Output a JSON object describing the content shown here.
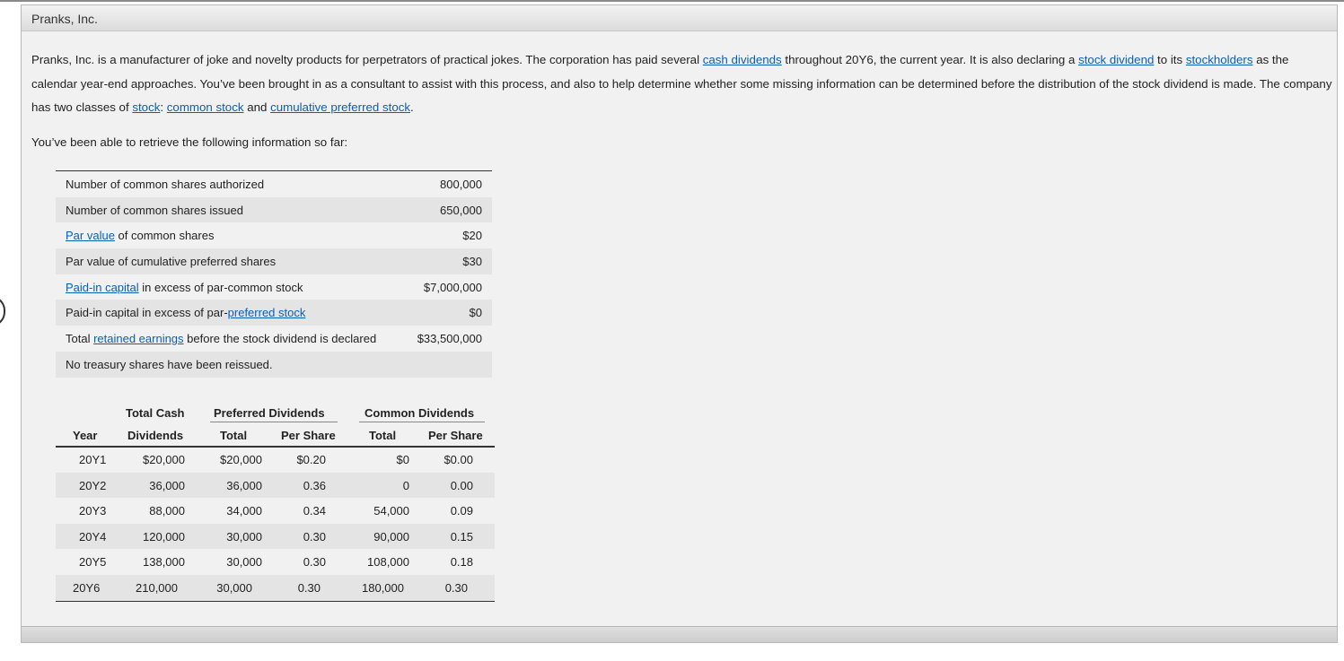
{
  "window": {
    "title": "Pranks, Inc."
  },
  "intro": {
    "t1": "Pranks, Inc. is a manufacturer of joke and novelty products for perpetrators of practical jokes. The corporation has paid several ",
    "l1": "cash dividends",
    "t2": " throughout 20Y6, the current year. It is also declaring a ",
    "l2": "stock dividend",
    "t3": " to its ",
    "l3": "stockholders",
    "t4": " as the calendar year-end approaches. You’ve been brought in as a consultant to assist with this process, and also to help determine whether some missing information can be determined before the distribution of the stock dividend is made. The company has two classes of ",
    "l4": "stock",
    "t5": ": ",
    "l5": "common stock",
    "t6": " and ",
    "l6": "cumulative preferred stock",
    "t7": "."
  },
  "lead": "You’ve been able to retrieve the following information so far:",
  "info": {
    "r1": {
      "label": "Number of common shares authorized",
      "value": "800,000"
    },
    "r2": {
      "label": "Number of common shares issued",
      "value": "650,000"
    },
    "r3": {
      "link": "Par value",
      "rest": " of common shares",
      "value": "$20"
    },
    "r4": {
      "label": "Par value of cumulative preferred shares",
      "value": "$30"
    },
    "r5": {
      "link": "Paid-in capital",
      "rest": " in excess of par-common stock",
      "value": "$7,000,000"
    },
    "r6": {
      "pre": "Paid-in capital in excess of par-",
      "link": "preferred stock",
      "value": "$0"
    },
    "r7": {
      "pre": "Total ",
      "link": "retained earnings",
      "rest": " before the stock dividend is declared",
      "value": "$33,500,000"
    },
    "r8": {
      "label": "No treasury shares have been reissued."
    }
  },
  "dividends": {
    "headers": {
      "total_cash_1": "Total Cash",
      "total_cash_2": "Dividends",
      "preferred": "Preferred Dividends",
      "common": "Common Dividends",
      "year": "Year",
      "pref_total": "Total",
      "pref_per": "Per Share",
      "com_total": "Total",
      "com_per": "Per Share"
    },
    "rows": [
      {
        "year": "20Y1",
        "cash": "$20,000",
        "pref_total": "$20,000",
        "pref_per": "$0.20",
        "com_total": "$0",
        "com_per": "$0.00"
      },
      {
        "year": "20Y2",
        "cash": "36,000",
        "pref_total": "36,000",
        "pref_per": "0.36",
        "com_total": "0",
        "com_per": "0.00"
      },
      {
        "year": "20Y3",
        "cash": "88,000",
        "pref_total": "34,000",
        "pref_per": "0.34",
        "com_total": "54,000",
        "com_per": "0.09"
      },
      {
        "year": "20Y4",
        "cash": "120,000",
        "pref_total": "30,000",
        "pref_per": "0.30",
        "com_total": "90,000",
        "com_per": "0.15"
      },
      {
        "year": "20Y5",
        "cash": "138,000",
        "pref_total": "30,000",
        "pref_per": "0.30",
        "com_total": "108,000",
        "com_per": "0.18"
      },
      {
        "year": "20Y6",
        "cash": "210,000",
        "pref_total": "30,000",
        "pref_per": "0.30",
        "com_total": "180,000",
        "com_per": "0.30"
      }
    ]
  }
}
